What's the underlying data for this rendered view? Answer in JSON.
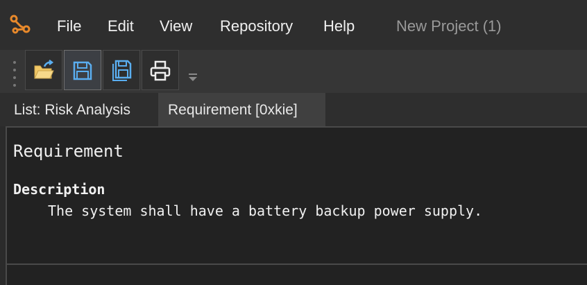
{
  "menubar": {
    "logo_icon": "graph-nodes-logo-icon",
    "items": [
      {
        "label": "File"
      },
      {
        "label": "Edit"
      },
      {
        "label": "View"
      },
      {
        "label": "Repository"
      },
      {
        "label": "Help"
      }
    ],
    "project_title": "New Project (1)"
  },
  "toolbar": {
    "buttons": [
      {
        "name": "open",
        "icon": "folder-open-icon"
      },
      {
        "name": "save",
        "icon": "save-icon",
        "active": true
      },
      {
        "name": "save-all",
        "icon": "save-all-icon"
      },
      {
        "name": "print",
        "icon": "printer-icon"
      }
    ],
    "overflow_icon": "chevron-down-icon"
  },
  "tabs": [
    {
      "label": "List: Risk Analysis",
      "selected": false
    },
    {
      "label": "Requirement [0xkie]",
      "selected": true
    }
  ],
  "document": {
    "title": "Requirement",
    "sections": [
      {
        "heading": "Description",
        "body": "The system shall have a battery backup power supply."
      }
    ]
  },
  "colors": {
    "accent_logo": "#e8892b",
    "icon_blue": "#5aaef0",
    "folder_yellow": "#f2c866"
  }
}
